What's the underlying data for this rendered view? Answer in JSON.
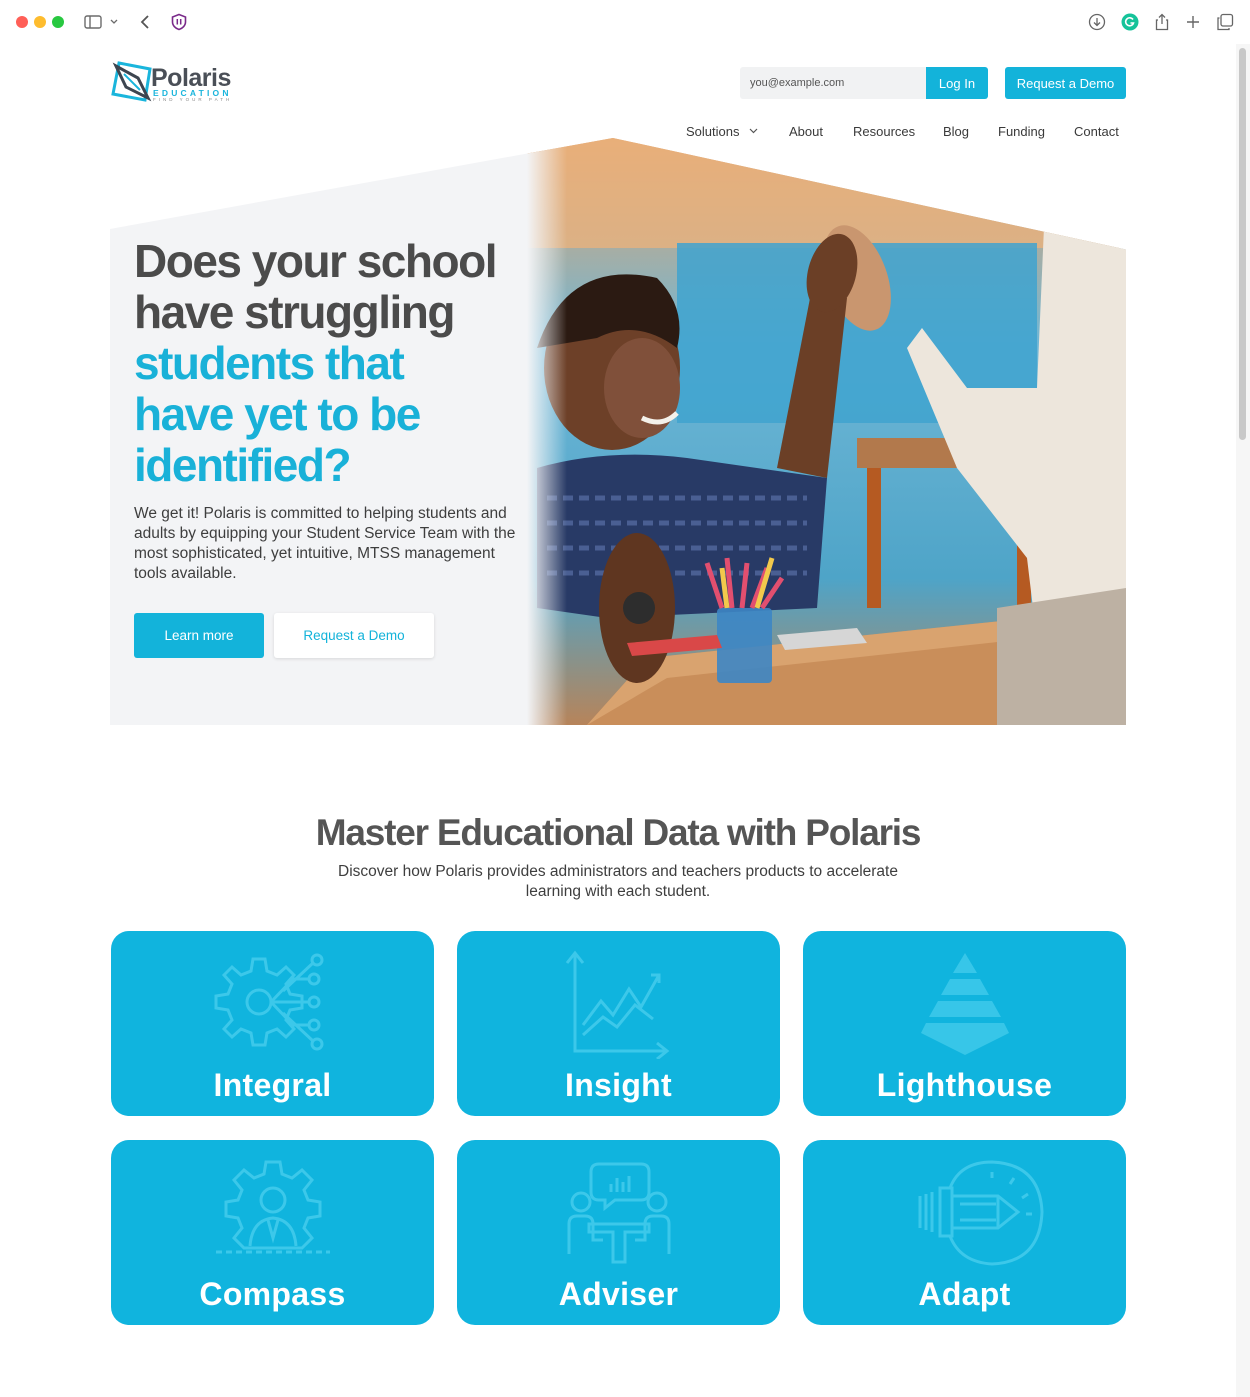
{
  "header": {
    "logo_word": "Polaris",
    "logo_sub": "EDUCATION",
    "logo_tagline": "FIND YOUR PATH",
    "email_placeholder": "you@example.com",
    "login_label": "Log In",
    "demo_label": "Request a Demo"
  },
  "nav": {
    "items": [
      {
        "label": "Solutions",
        "has_dropdown": true
      },
      {
        "label": "About"
      },
      {
        "label": "Resources"
      },
      {
        "label": "Blog"
      },
      {
        "label": "Funding"
      },
      {
        "label": "Contact"
      }
    ]
  },
  "hero": {
    "title_dark": [
      "Does your school",
      "have struggling"
    ],
    "title_blue": [
      "students that",
      "have yet to be",
      "identified?"
    ],
    "body": "We get it! Polaris is committed to helping students and adults by equipping your Student Service Team with the most sophisticated, yet intuitive, MTSS management tools available.",
    "learn_more_label": "Learn more",
    "demo_label": "Request a Demo"
  },
  "section": {
    "title": "Master Educational Data with Polaris",
    "subtitle": "Discover how Polaris provides administrators and teachers products to accelerate learning with each student."
  },
  "products": [
    {
      "name": "Integral",
      "icon": "gear-network-icon"
    },
    {
      "name": "Insight",
      "icon": "line-chart-icon"
    },
    {
      "name": "Lighthouse",
      "icon": "pyramid-icon"
    },
    {
      "name": "Compass",
      "icon": "gear-person-icon"
    },
    {
      "name": "Adviser",
      "icon": "meeting-chat-icon"
    },
    {
      "name": "Adapt",
      "icon": "lightbulb-pencil-icon"
    }
  ],
  "colors": {
    "brand_blue": "#13b3da",
    "card_blue": "#10b4de",
    "heading_gray": "#4b4b4b",
    "hero_bg": "#f3f4f6"
  }
}
